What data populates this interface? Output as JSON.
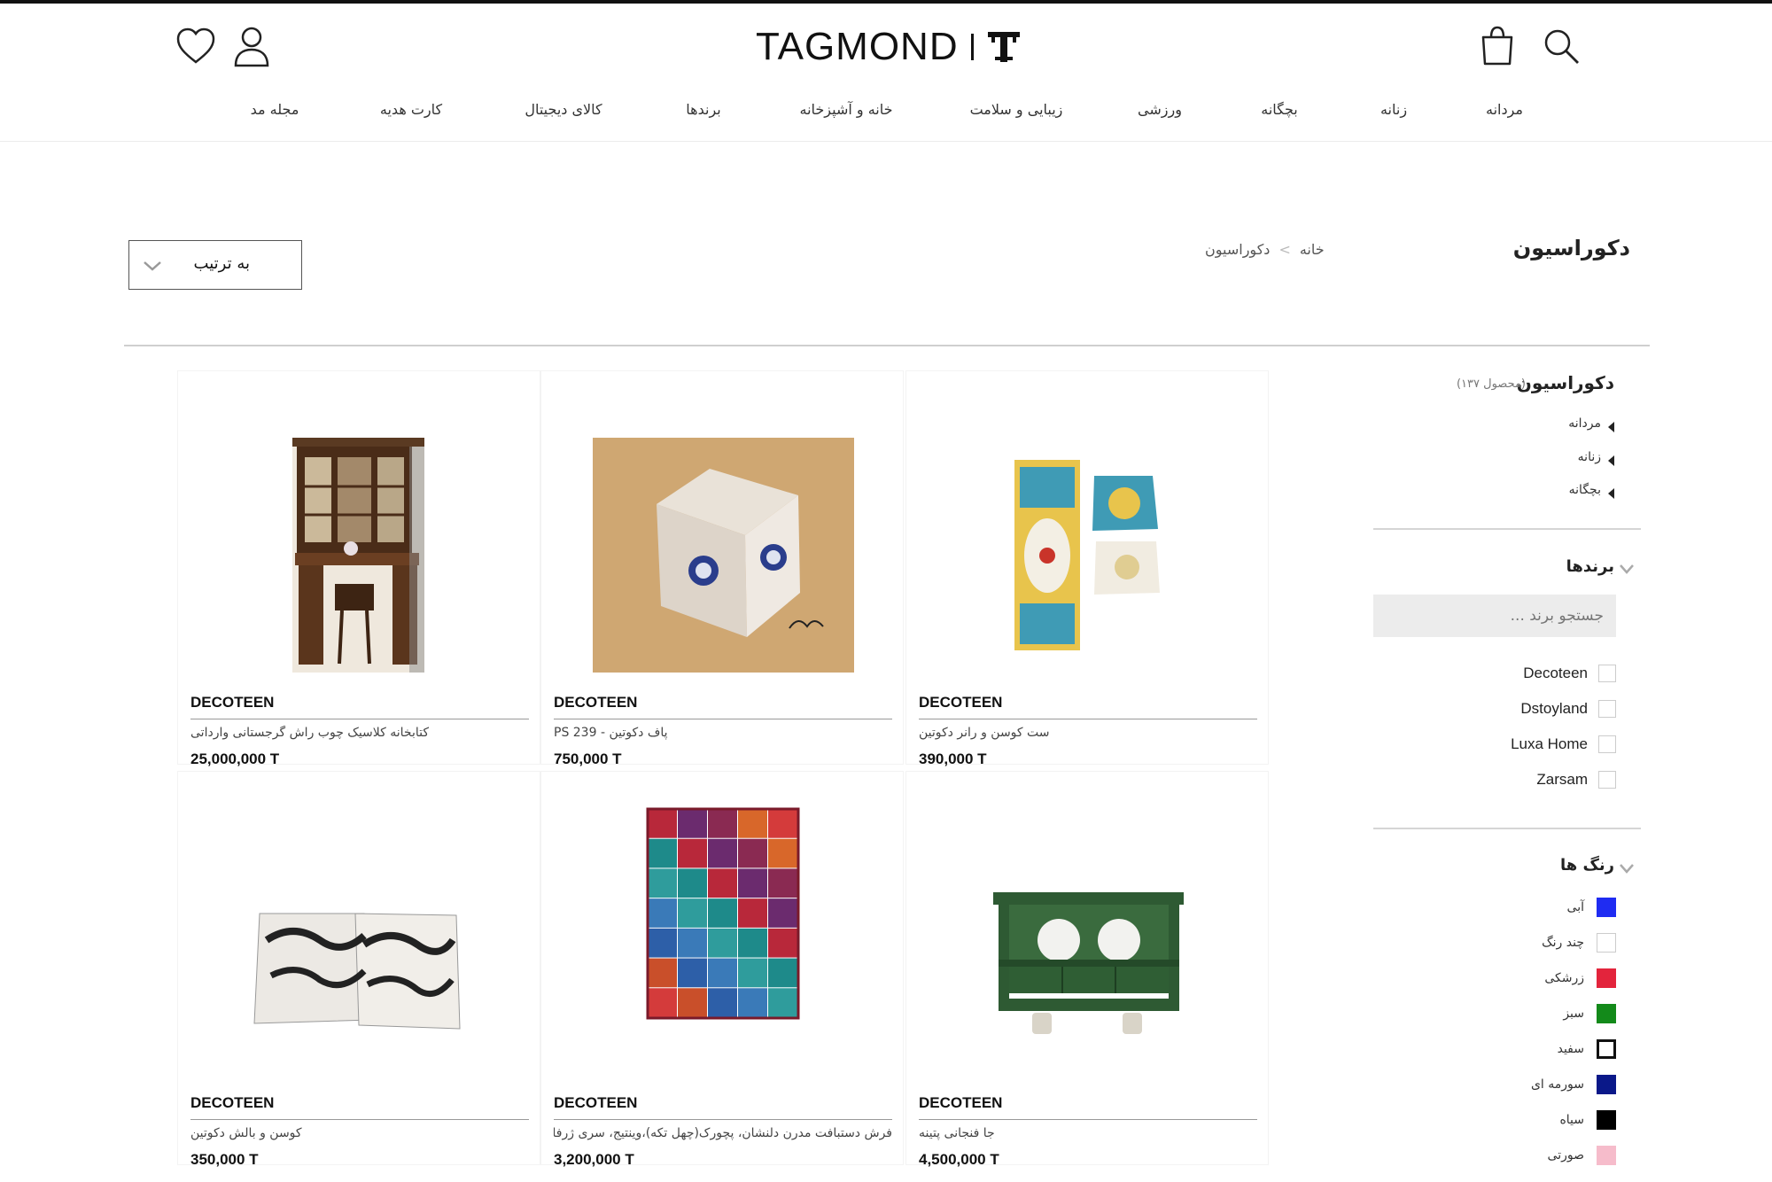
{
  "header": {
    "logo_text": "TAGMOND",
    "nav": [
      "مردانه",
      "زنانه",
      "بچگانه",
      "ورزشی",
      "زیبایی و سلامت",
      "خانه و آشپزخانه",
      "برندها",
      "کالای دیجیتال",
      "کارت هدیه",
      "مجله مد"
    ]
  },
  "page": {
    "title": "دکوراسیون",
    "breadcrumb": [
      "خانه",
      ">",
      "دکوراسیون"
    ],
    "sort_label": "به ترتیب"
  },
  "sidebar": {
    "category_title": "دکوراسیون",
    "category_count": "(محصول ۱۳۷)",
    "categories": [
      "مردانه",
      "زنانه",
      "بچگانه"
    ],
    "brands_title": "برندها",
    "brand_search_placeholder": "جستجو برند ...",
    "brands": [
      "Decoteen",
      "Dstoyland",
      "Luxa Home",
      "Zarsam"
    ],
    "colors_title": "رنگ ها",
    "colors": [
      {
        "name": "آبی",
        "hex": "#1f2cf2"
      },
      {
        "name": "چند رنگ",
        "hex": "#ffffff"
      },
      {
        "name": "زرشکی",
        "hex": "#e3243c"
      },
      {
        "name": "سبز",
        "hex": "#138a1a"
      },
      {
        "name": "سفید",
        "hex": "#ffffff"
      },
      {
        "name": "سورمه ای",
        "hex": "#0a1889"
      },
      {
        "name": "سیاه",
        "hex": "#000000"
      },
      {
        "name": "صورتی",
        "hex": "#f6bccb"
      }
    ]
  },
  "products": [
    {
      "brand": "DECOTEEN",
      "name": "کتابخانه کلاسیک چوب راش گرجستانی وارداتی",
      "price": "25,000,000 T",
      "image": "wooden-corner-desk-bookcase"
    },
    {
      "brand": "DECOTEEN",
      "name": "پاف دکوتین - PS 239",
      "price": "750,000 T",
      "image": "cube-pouf"
    },
    {
      "brand": "DECOTEEN",
      "name": "ست کوسن و رانر دکوتین",
      "price": "390,000 T",
      "image": "cushion-runner-set"
    },
    {
      "brand": "DECOTEEN",
      "name": "کوسن و بالش دکوتین",
      "price": "350,000 T",
      "image": "calligraphy-pillows"
    },
    {
      "brand": "DECOTEEN",
      "name": "فرش دستبافت مدرن دلنشان، پچورک(چهل تکه)،وینتیج، سری ژرفا،",
      "price": "3,200,000 T",
      "image": "patchwork-rug"
    },
    {
      "brand": "DECOTEEN",
      "name": "جا فنجانی پتینه",
      "price": "4,500,000 T",
      "image": "green-cup-shelf"
    }
  ]
}
